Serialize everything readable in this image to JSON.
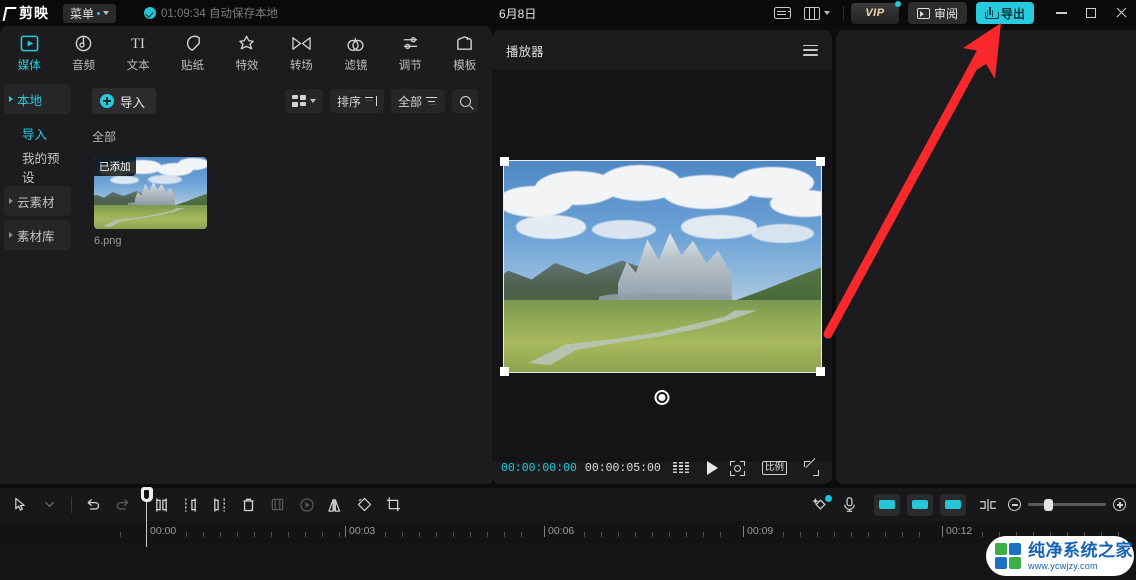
{
  "titlebar": {
    "app_name": "剪映",
    "menu_label": "菜单",
    "autosave_text": "01:09:34 自动保存本地",
    "project_title": "6月8日",
    "keyboard_icon": "keyboard-icon",
    "layout_icon": "layout-icon",
    "vip_label": "VIP",
    "review_label": "审阅",
    "export_label": "导出",
    "minimize_label": "minimize",
    "maximize_label": "maximize",
    "close_label": "close",
    "accent_color": "#26cbdd"
  },
  "tabs": [
    {
      "label": "媒体",
      "icon": "media-icon",
      "active": true
    },
    {
      "label": "音频",
      "icon": "audio-icon",
      "active": false
    },
    {
      "label": "文本",
      "icon": "text-icon",
      "active": false
    },
    {
      "label": "贴纸",
      "icon": "sticker-icon",
      "active": false
    },
    {
      "label": "特效",
      "icon": "effects-icon",
      "active": false
    },
    {
      "label": "转场",
      "icon": "transition-icon",
      "active": false
    },
    {
      "label": "滤镜",
      "icon": "filter-icon",
      "active": false
    },
    {
      "label": "调节",
      "icon": "adjust-icon",
      "active": false
    },
    {
      "label": "模板",
      "icon": "template-icon",
      "active": false
    }
  ],
  "sidebar": {
    "items": [
      {
        "label": "本地",
        "type": "group",
        "active": true,
        "expandable": true
      },
      {
        "label": "导入",
        "type": "sub",
        "active": true,
        "expandable": false
      },
      {
        "label": "我的预设",
        "type": "sub",
        "active": false,
        "expandable": false
      },
      {
        "label": "云素材",
        "type": "group",
        "active": false,
        "expandable": true
      },
      {
        "label": "素材库",
        "type": "group",
        "active": false,
        "expandable": true
      }
    ]
  },
  "media_panel": {
    "import_label": "导入",
    "view_mode_icon": "grid-view-icon",
    "sort_label": "排序",
    "filter_label": "全部",
    "search_icon": "search-icon",
    "section_label": "全部",
    "items": [
      {
        "name": "6.png",
        "badge": "已添加"
      }
    ]
  },
  "player": {
    "title": "播放器",
    "menu_icon": "hamburger-icon",
    "current_time": "00:00:00:00",
    "total_time": "00:00:05:00",
    "frames_icon": "frames-icon",
    "play_icon": "play-icon",
    "fit_icon": "fit-to-screen-icon",
    "ratio_label": "比例",
    "fullscreen_icon": "fullscreen-icon"
  },
  "timeline": {
    "tools": [
      {
        "name": "select-tool",
        "icon": "cursor-icon",
        "dim": false
      },
      {
        "name": "tool-dropdown",
        "icon": "chevron-down-icon",
        "dim": true
      },
      {
        "name": "undo",
        "icon": "undo-icon",
        "dim": false
      },
      {
        "name": "redo",
        "icon": "redo-icon",
        "dim": true
      },
      {
        "name": "split",
        "icon": "split-icon",
        "dim": false
      },
      {
        "name": "trim-left",
        "icon": "trim-left-icon",
        "dim": false
      },
      {
        "name": "trim-right",
        "icon": "trim-right-icon",
        "dim": false
      },
      {
        "name": "delete",
        "icon": "trash-icon",
        "dim": false
      },
      {
        "name": "crop-clip",
        "icon": "crop-clip-icon",
        "dim": true
      },
      {
        "name": "speed",
        "icon": "speed-icon",
        "dim": true
      },
      {
        "name": "mirror",
        "icon": "mirror-icon",
        "dim": false
      },
      {
        "name": "rotate",
        "icon": "rotate-icon",
        "dim": false
      },
      {
        "name": "crop",
        "icon": "crop-icon",
        "dim": false
      }
    ],
    "right_tools": [
      {
        "name": "auto-edit",
        "icon": "magic-wand-icon",
        "badge": true
      },
      {
        "name": "record",
        "icon": "microphone-icon",
        "badge": false
      }
    ],
    "ruler_labels": [
      "00:00",
      "00:03",
      "00:06",
      "00:09",
      "00:12"
    ],
    "zoom_out_icon": "zoom-out-icon",
    "zoom_in_icon": "zoom-in-icon",
    "playhead_time": "00:00"
  },
  "annotation": {
    "arrow_color": "#f8282d",
    "arrow_target": "export-button"
  },
  "watermark": {
    "title": "纯净系统之家",
    "url": "www.ycwjzy.com"
  }
}
